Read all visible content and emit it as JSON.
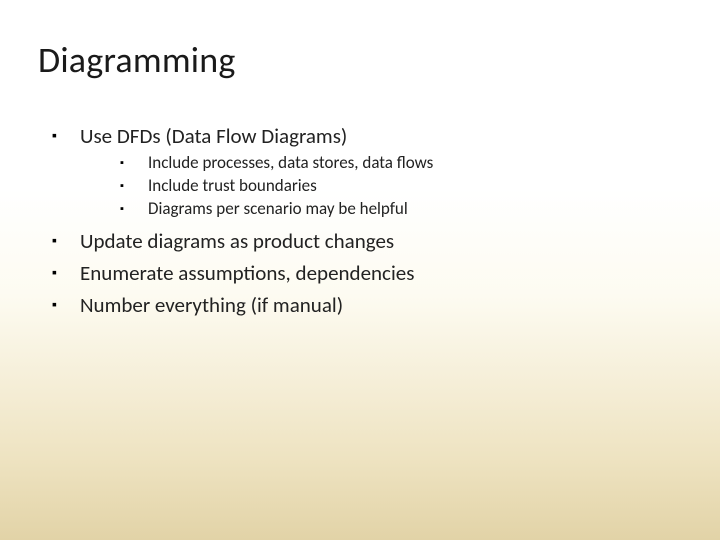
{
  "title": "Diagramming",
  "bullets": {
    "b1": "Use DFDs (Data Flow Diagrams)",
    "b1a": "Include processes, data stores, data flows",
    "b1b": "Include trust boundaries",
    "b1c": "Diagrams per scenario may be helpful",
    "b2": "Update diagrams as product changes",
    "b3": "Enumerate assumptions, dependencies",
    "b4": "Number everything (if manual)"
  }
}
